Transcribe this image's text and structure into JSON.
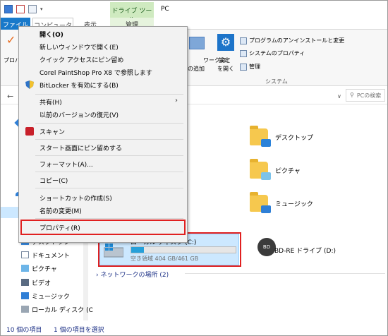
{
  "window": {
    "title": "PC",
    "contextual_tab_header": "ドライブ ツール",
    "qat_dropdown": "▾"
  },
  "tabs": [
    {
      "label": "ファイル"
    },
    {
      "label": "コンピューター"
    },
    {
      "label": "表示"
    },
    {
      "label": "管理"
    }
  ],
  "ribbon": {
    "left_label": "プロパ",
    "network": {
      "line1": "ワークの",
      "line2": "の追加"
    },
    "settings": {
      "line1": "設定",
      "line2": "を開く"
    },
    "system_items": [
      "プログラムのアンインストールと変更",
      "システムのプロパティ",
      "管理"
    ],
    "system_group_label": "システム"
  },
  "address": {
    "chevron": "∨",
    "search_placeholder": "PCの検索",
    "search_icon_glyph": "⚲"
  },
  "nav": {
    "items": [
      {
        "label": "デスクトップ"
      },
      {
        "label": "ドキュメント"
      },
      {
        "label": "ピクチャ"
      },
      {
        "label": "ビデオ"
      },
      {
        "label": "ミュージック"
      },
      {
        "label": "ローカル ディスク (C"
      }
    ]
  },
  "content": {
    "folders": [
      {
        "label": "デスクトップ"
      },
      {
        "label": "ピクチャ"
      },
      {
        "label": "ミュージック"
      }
    ],
    "drive_c": {
      "name": "ローカル ディスク (C:)",
      "free_text": "空き領域 404 GB/461 GB",
      "used_fraction": 0.124
    },
    "bd_drive": {
      "label": "BD-RE ドライブ (D:)",
      "badge": "BD"
    },
    "network_section": "ネットワークの場所 (2)"
  },
  "context_menu": {
    "items": [
      {
        "label": "開く(O)"
      },
      {
        "label": "新しいウィンドウで開く(E)"
      },
      {
        "label": "クイック アクセスにピン留め"
      },
      {
        "label": "Corel PaintShop Pro X8 で参照します"
      },
      {
        "label": "BitLocker を有効にする(B)"
      },
      {
        "label": "共有(H)"
      },
      {
        "label": "以前のバージョンの復元(V)"
      },
      {
        "label": "スキャン"
      },
      {
        "label": "スタート画面にピン留めする"
      },
      {
        "label": "フォーマット(A)..."
      },
      {
        "label": "コピー(C)"
      },
      {
        "label": "ショートカットの作成(S)"
      },
      {
        "label": "名前の変更(M)"
      },
      {
        "label": "プロパティ(R)"
      }
    ],
    "submenu_arrow": "›"
  },
  "status": {
    "count": "10 個の項目",
    "selected": "1 個の項目を選択"
  },
  "colors": {
    "accent": "#1979ca",
    "highlight_red": "#e02020",
    "selection": "#cce8ff",
    "drive_bar": "#26a0da"
  }
}
